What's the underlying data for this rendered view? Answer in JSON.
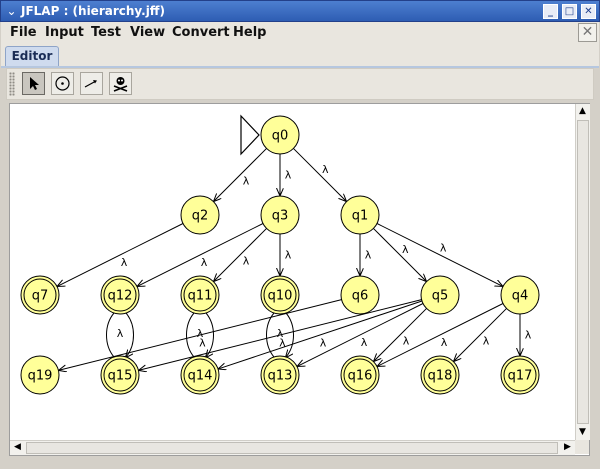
{
  "window": {
    "title": "JFLAP : (hierarchy.jff)"
  },
  "menu": [
    "File",
    "Input",
    "Test",
    "View",
    "Convert",
    "Help"
  ],
  "tabs": [
    {
      "label": "Editor"
    }
  ],
  "toolbar": {
    "tools": [
      "attribute-editor-pointer",
      "state-creator",
      "transition-creator",
      "deleter"
    ]
  },
  "automaton": {
    "states": [
      {
        "id": "q0",
        "label": "q0",
        "initial": true,
        "final": false
      },
      {
        "id": "q1",
        "label": "q1",
        "final": false
      },
      {
        "id": "q2",
        "label": "q2",
        "final": false
      },
      {
        "id": "q3",
        "label": "q3",
        "final": false
      },
      {
        "id": "q4",
        "label": "q4",
        "final": false
      },
      {
        "id": "q5",
        "label": "q5",
        "final": false
      },
      {
        "id": "q6",
        "label": "q6",
        "final": false
      },
      {
        "id": "q7",
        "label": "q7",
        "final": true
      },
      {
        "id": "q10",
        "label": "q10",
        "final": true
      },
      {
        "id": "q11",
        "label": "q11",
        "final": true
      },
      {
        "id": "q12",
        "label": "q12",
        "final": true
      },
      {
        "id": "q13",
        "label": "q13",
        "final": true
      },
      {
        "id": "q14",
        "label": "q14",
        "final": true
      },
      {
        "id": "q15",
        "label": "q15",
        "final": true
      },
      {
        "id": "q16",
        "label": "q16",
        "final": true
      },
      {
        "id": "q17",
        "label": "q17",
        "final": true
      },
      {
        "id": "q18",
        "label": "q18",
        "final": true
      },
      {
        "id": "q19",
        "label": "q19",
        "final": false
      }
    ],
    "transitions": [
      {
        "from": "q0",
        "to": "q2",
        "label": "λ"
      },
      {
        "from": "q0",
        "to": "q3",
        "label": "λ"
      },
      {
        "from": "q0",
        "to": "q1",
        "label": "λ"
      },
      {
        "from": "q2",
        "to": "q7",
        "label": "λ"
      },
      {
        "from": "q3",
        "to": "q12",
        "label": "λ"
      },
      {
        "from": "q3",
        "to": "q11",
        "label": "λ"
      },
      {
        "from": "q3",
        "to": "q10",
        "label": "λ"
      },
      {
        "from": "q1",
        "to": "q6",
        "label": "λ"
      },
      {
        "from": "q1",
        "to": "q5",
        "label": "λ"
      },
      {
        "from": "q1",
        "to": "q4",
        "label": "λ"
      },
      {
        "from": "q6",
        "to": "q19",
        "label": "λ"
      },
      {
        "from": "q5",
        "to": "q15",
        "label": "λ"
      },
      {
        "from": "q5",
        "to": "q14",
        "label": "λ"
      },
      {
        "from": "q5",
        "to": "q13",
        "label": "λ"
      },
      {
        "from": "q5",
        "to": "q16",
        "label": "λ"
      },
      {
        "from": "q4",
        "to": "q16",
        "label": "λ"
      },
      {
        "from": "q4",
        "to": "q18",
        "label": "λ"
      },
      {
        "from": "q4",
        "to": "q17",
        "label": "λ"
      },
      {
        "from": "q15",
        "to": "q12",
        "label": "λ",
        "curved": true
      },
      {
        "from": "q14",
        "to": "q11",
        "label": "λ",
        "curved": true
      },
      {
        "from": "q13",
        "to": "q10",
        "label": "λ",
        "curved": true
      }
    ]
  }
}
